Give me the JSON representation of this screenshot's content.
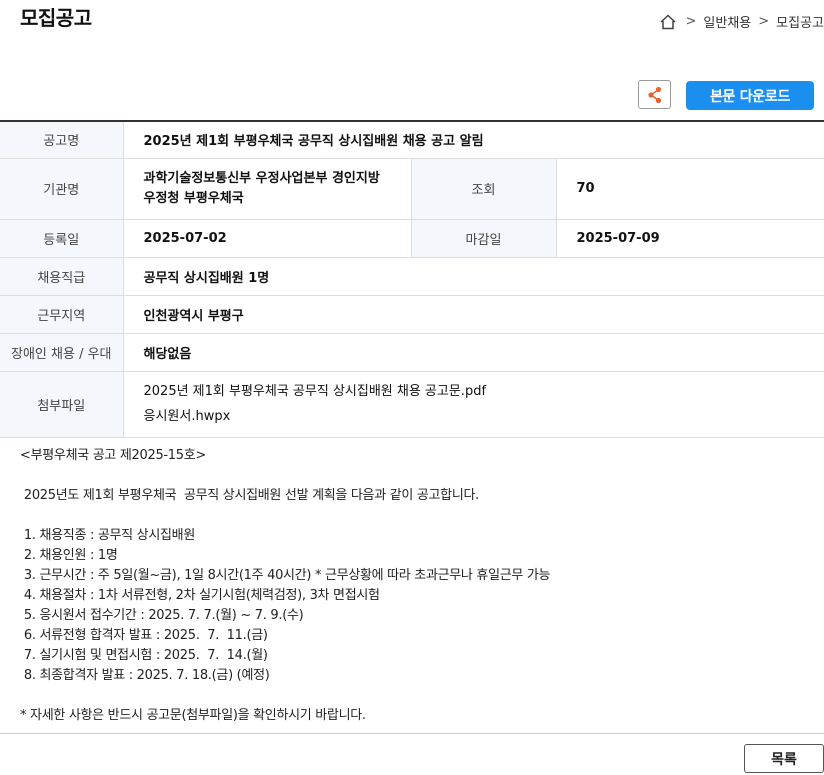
{
  "header": {
    "title": "모집공고",
    "breadcrumb": {
      "items": [
        "일반채용",
        "모집공고"
      ],
      "separator": ">"
    }
  },
  "actions": {
    "share_icon": "share-icon",
    "download_label": "본문 다운로드",
    "accent_color": "#1a8ff0",
    "share_color": "#e8632b"
  },
  "info": {
    "title_label": "공고명",
    "title_value": "2025년 제1회 부평우체국 공무직 상시집배원 채용 공고 알림",
    "org_label": "기관명",
    "org_value_line1": "과학기술정보통신부 우정사업본부 경인지방",
    "org_value_line2": "우정청 부평우체국",
    "views_label": "조회",
    "views_value": "70",
    "reg_label": "등록일",
    "reg_value": "2025-07-02",
    "deadline_label": "마감일",
    "deadline_value": "2025-07-09",
    "grade_label": "채용직급",
    "grade_value": "공무직 상시집배원 1명",
    "region_label": "근무지역",
    "region_value": "인천광역시 부평구",
    "disabled_label": "장애인 채용 / 우대",
    "disabled_value": "해당없음",
    "files_label": "첨부파일",
    "files": [
      "2025년 제1회 부평우체국 공무직 상시집배원 채용 공고문.pdf",
      "응시원서.hwpx"
    ]
  },
  "body": {
    "lines": [
      "<부평우체국 공고 제2025-15호>",
      "",
      " 2025년도 제1회 부평우체국  공무직 상시집배원 선발 계획을 다음과 같이 공고합니다.",
      "",
      " 1. 채용직종 : 공무직 상시집배원",
      " 2. 채용인원 : 1명",
      " 3. 근무시간 : 주 5일(월~금), 1일 8시간(1주 40시간) * 근무상황에 따라 초과근무나 휴일근무 가능",
      " 4. 채용절차 : 1차 서류전형, 2차 실기시험(체력검정), 3차 면접시험",
      " 5. 응시원서 접수기간 : 2025. 7. 7.(월) ~ 7. 9.(수)",
      " 6. 서류전형 합격자 발표 : 2025.  7.  11.(금)",
      " 7. 실기시험 및 면접시험 : 2025.  7.  14.(월)",
      " 8. 최종합격자 발표 : 2025. 7. 18.(금) (예정)",
      "",
      "* 자세한 사항은 반드시 공고문(첨부파일)을 확인하시기 바랍니다."
    ]
  },
  "footer": {
    "list_label": "목록"
  }
}
